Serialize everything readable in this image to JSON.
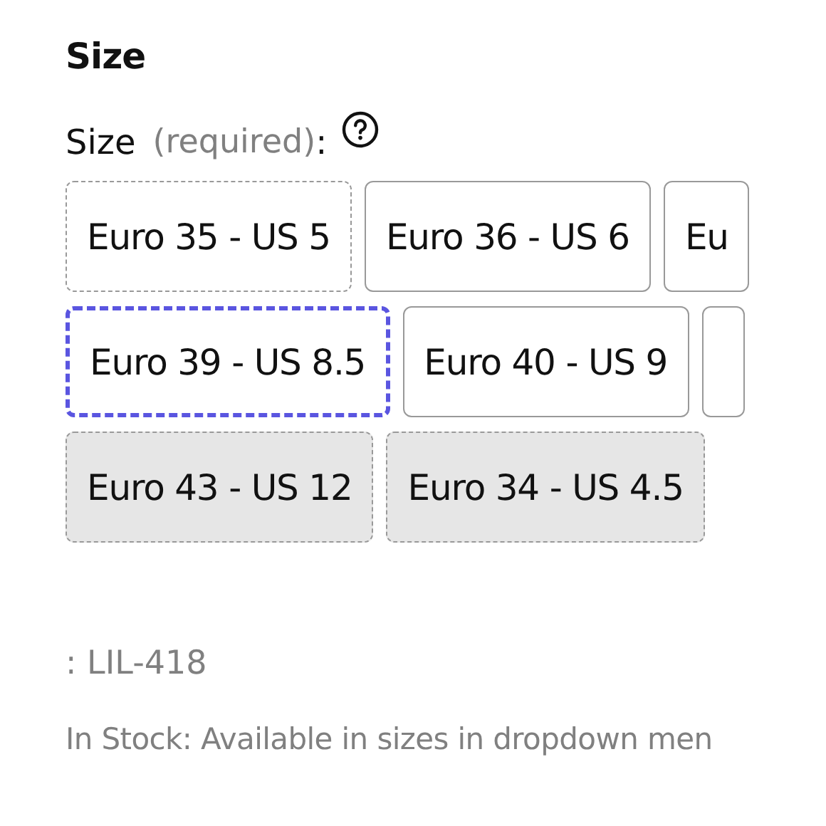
{
  "heading": "Size",
  "field_label": {
    "name": "Size",
    "hint": "(required)",
    "colon": ":"
  },
  "size_rows": [
    [
      {
        "label": "Euro 35 - US 5",
        "kind": "unavailable"
      },
      {
        "label": "Euro 36 - US 6",
        "kind": "available"
      },
      {
        "label": "Eu",
        "kind": "available"
      }
    ],
    [
      {
        "label": "Euro 39 - US 8.5",
        "kind": "focused"
      },
      {
        "label": "Euro 40 - US 9",
        "kind": "available"
      },
      {
        "kind": "available"
      }
    ],
    [
      {
        "label": "Euro 43 - US 12",
        "kind": "sold_out"
      },
      {
        "label": "Euro 34 - US 4.5",
        "kind": "sold_out"
      }
    ]
  ],
  "sku": ": LIL-418",
  "stock_note": "In Stock: Available in sizes in dropdown men"
}
